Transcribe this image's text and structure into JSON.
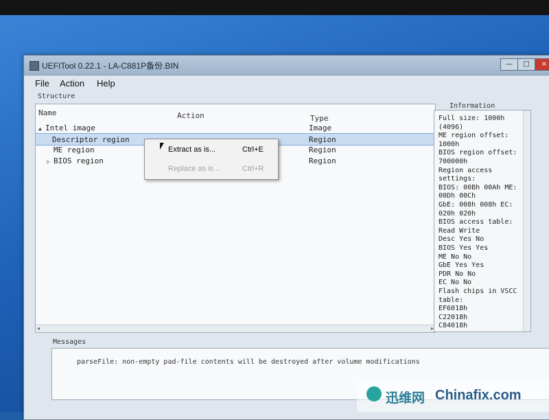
{
  "window": {
    "title": "UEFITool 0.22.1 - LA-C881P备份.BIN",
    "controls": {
      "minimize": "—",
      "maximize": "□",
      "close": "×"
    }
  },
  "menubar": {
    "file": "File",
    "action": "Action",
    "help": "Help"
  },
  "structure": {
    "label": "Structure",
    "columns": {
      "name": "Name",
      "action": "Action",
      "type": "Type"
    },
    "rows": [
      {
        "name": "Intel image",
        "type": "Image",
        "expander": "▲"
      },
      {
        "name": "Descriptor region",
        "type": "Region",
        "expander": ""
      },
      {
        "name": "ME region",
        "type": "Region",
        "expander": ""
      },
      {
        "name": "BIOS region",
        "type": "Region",
        "expander": "▷"
      }
    ],
    "selected_index": 1
  },
  "context_menu": {
    "items": [
      {
        "label": "Extract as is...",
        "shortcut": "Ctrl+E",
        "enabled": true
      },
      {
        "label": "Replace as is...",
        "shortcut": "Ctrl+R",
        "enabled": false
      }
    ]
  },
  "information": {
    "label": "Information",
    "lines": [
      "Full size: 1000h",
      "(4096)",
      "ME region offset:",
      "1000h",
      "BIOS region offset:",
      "700000h",
      "Region access",
      "settings:",
      "BIOS: 00Bh 00Ah ME:",
      "00Dh 00Ch",
      "GbE:  008h 008h EC:",
      "020h 020h",
      "BIOS access table:",
      "      Read  Write",
      "Desc  Yes   No",
      "BIOS  Yes   Yes",
      "ME    No    No",
      "GbE   Yes   Yes",
      "PDR   No    No",
      "EC    No    No",
      "Flash chips in VSCC",
      "table:",
      "EF6018h",
      "C22018h",
      "C84018h"
    ]
  },
  "messages": {
    "label": "Messages",
    "lines": [
      "parseFile: non-empty pad-file contents will be destroyed after volume modifications"
    ]
  },
  "watermark": {
    "cn": "迅维网",
    "en": "Chinafix.com"
  },
  "colors": {
    "selection": "#c8dcf2",
    "close_button": "#c63b2f",
    "desktop": "#1e62b8"
  }
}
